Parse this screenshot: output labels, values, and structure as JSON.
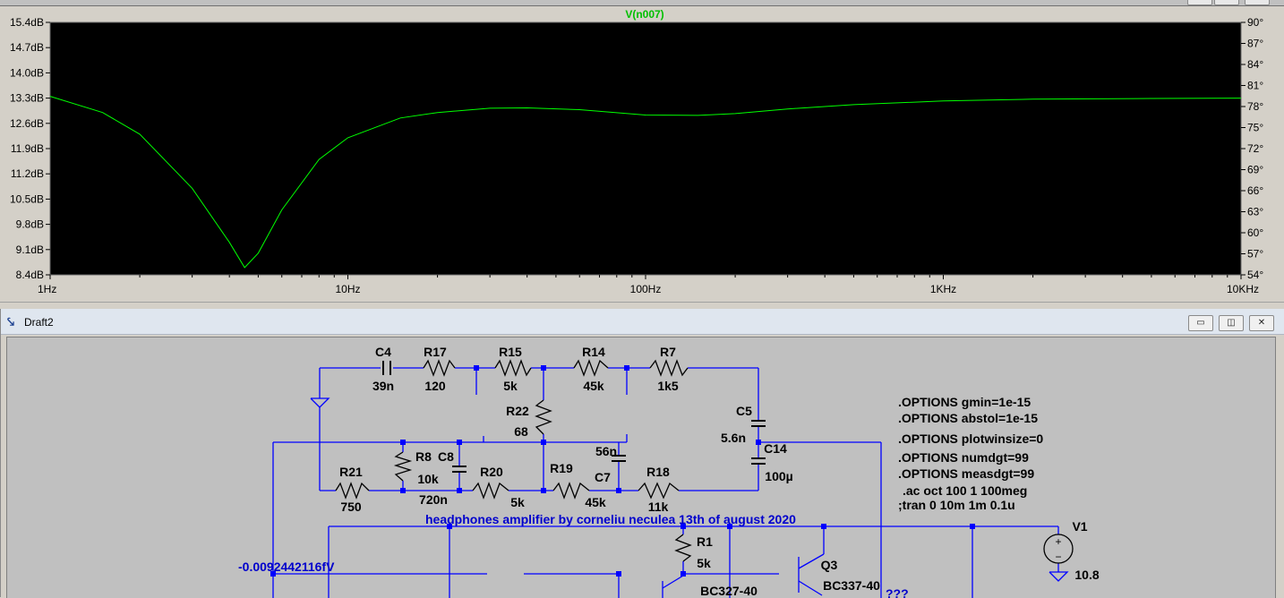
{
  "plot": {
    "trace_label": "V(n007)",
    "trace_color": "#00ff00",
    "y_left_ticks": [
      "15.4dB",
      "14.7dB",
      "14.0dB",
      "13.3dB",
      "12.6dB",
      "11.9dB",
      "11.2dB",
      "10.5dB",
      "9.8dB",
      "9.1dB",
      "8.4dB"
    ],
    "y_right_ticks": [
      "90°",
      "87°",
      "84°",
      "81°",
      "78°",
      "75°",
      "72°",
      "69°",
      "66°",
      "63°",
      "60°",
      "57°",
      "54°"
    ],
    "x_ticks": [
      "1Hz",
      "10Hz",
      "100Hz",
      "1KHz",
      "10KHz"
    ],
    "chart_data": {
      "type": "line",
      "title": "V(n007)",
      "x_scale": "log",
      "xlim": [
        1,
        10000
      ],
      "ylim": [
        8.4,
        15.4
      ],
      "y2lim": [
        54,
        90
      ],
      "grid": false,
      "series": [
        {
          "name": "V(n007)",
          "x": [
            1,
            1.5,
            2,
            3,
            4,
            4.5,
            5,
            6,
            8,
            10,
            15,
            20,
            30,
            40,
            60,
            100,
            150,
            200,
            300,
            500,
            1000,
            2000,
            5000,
            10000
          ],
          "y": [
            13.35,
            12.9,
            12.3,
            10.8,
            9.3,
            8.6,
            9.0,
            10.2,
            11.6,
            12.2,
            12.75,
            12.9,
            13.02,
            13.03,
            12.98,
            12.83,
            12.82,
            12.87,
            13.0,
            13.12,
            13.22,
            13.27,
            13.29,
            13.3
          ]
        }
      ]
    }
  },
  "schematic_window": {
    "title": "Draft2",
    "minimize_glyph": "▭",
    "restore_glyph": "◫",
    "close_glyph": "✕"
  },
  "schematic": {
    "components": [
      {
        "ref": "C4",
        "value": "39n"
      },
      {
        "ref": "R17",
        "value": "120"
      },
      {
        "ref": "R15",
        "value": "5k"
      },
      {
        "ref": "R14",
        "value": "45k"
      },
      {
        "ref": "R7",
        "value": "1k5"
      },
      {
        "ref": "R22",
        "value": "68"
      },
      {
        "ref": "C5",
        "value": "5.6n"
      },
      {
        "ref": "C14",
        "value": "100µ"
      },
      {
        "ref": "R8",
        "value": "10k"
      },
      {
        "ref": "C8",
        "value": "720n"
      },
      {
        "ref": "R20",
        "value": "5k"
      },
      {
        "ref": "R19",
        "value": "45k"
      },
      {
        "ref": "C7",
        "value": "56n"
      },
      {
        "ref": "R18",
        "value": "11k"
      },
      {
        "ref": "R21",
        "value": "750"
      },
      {
        "ref": "R1",
        "value": "5k"
      },
      {
        "ref": "Q3",
        "value": "BC337-40"
      },
      {
        "ref": "V1",
        "value": "10.8"
      }
    ],
    "q_other_model": "BC327-40",
    "spice_directives": [
      ".OPTIONS gmin=1e-15",
      ".OPTIONS abstol=1e-15",
      ".OPTIONS plotwinsize=0",
      ".OPTIONS numdgt=99",
      ".OPTIONS measdgt=99",
      ".ac oct 100 1 100meg",
      ";tran 0 10m 1m 0.1u"
    ],
    "comment": "headphones amplifier by corneliu neculea 13th of august 2020",
    "node_voltage": "-0.0092442116fV",
    "unknown_marker": "???",
    "wire_color": "#0000ff",
    "text_color": "#000000",
    "comment_color": "#0000cc"
  }
}
